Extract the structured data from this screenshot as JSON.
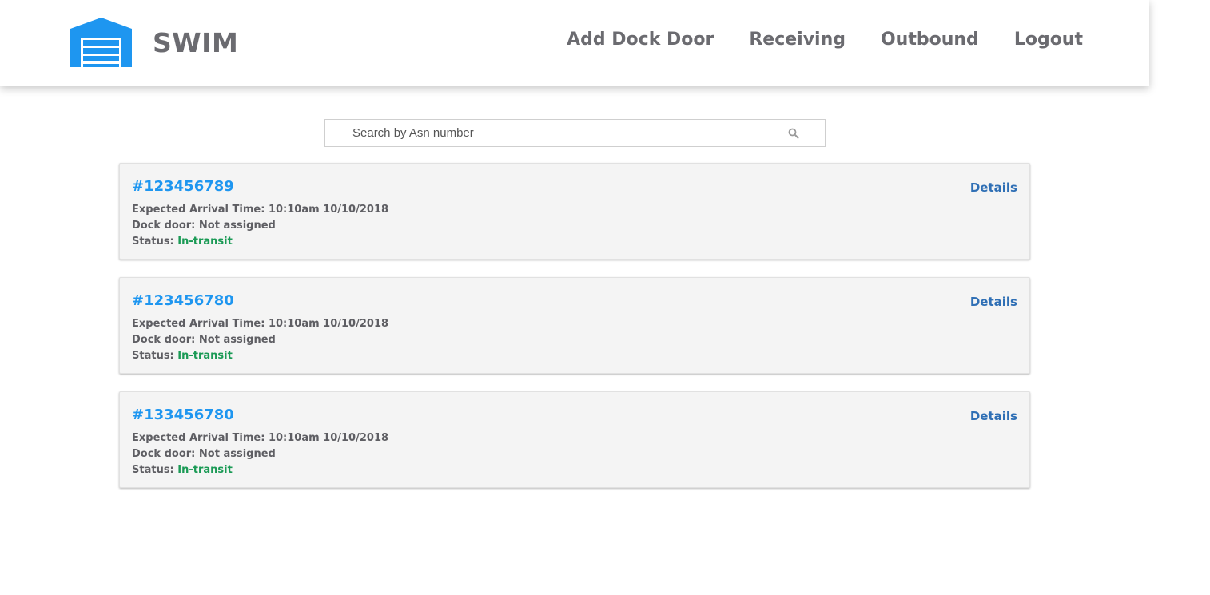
{
  "brand": {
    "name": "SWIM",
    "logo_icon": "warehouse-garage-door-icon",
    "logo_color": "#1e96f0"
  },
  "nav": {
    "items": [
      {
        "label": "Add Dock Door"
      },
      {
        "label": "Receiving"
      },
      {
        "label": "Outbound"
      },
      {
        "label": "Logout"
      }
    ]
  },
  "search": {
    "placeholder": "Search by Asn number",
    "value": "",
    "icon": "search-icon"
  },
  "labels": {
    "expected_arrival": "Expected Arrival Time:",
    "dock_door": "Dock door:",
    "status": "Status:",
    "details": "Details"
  },
  "shipments": [
    {
      "asn": "#123456789",
      "expected_arrival": "10:10am 10/10/2018",
      "dock_door": "Not assigned",
      "status": "In-transit"
    },
    {
      "asn": "#123456780",
      "expected_arrival": "10:10am 10/10/2018",
      "dock_door": "Not assigned",
      "status": "In-transit"
    },
    {
      "asn": "#133456780",
      "expected_arrival": "10:10am 10/10/2018",
      "dock_door": "Not assigned",
      "status": "In-transit"
    }
  ],
  "colors": {
    "accent": "#1e96f0",
    "details_link": "#2f6fb5",
    "status_in_transit": "#1a9a55",
    "nav_text": "#6b6b70",
    "card_background": "#f4f4f4"
  }
}
